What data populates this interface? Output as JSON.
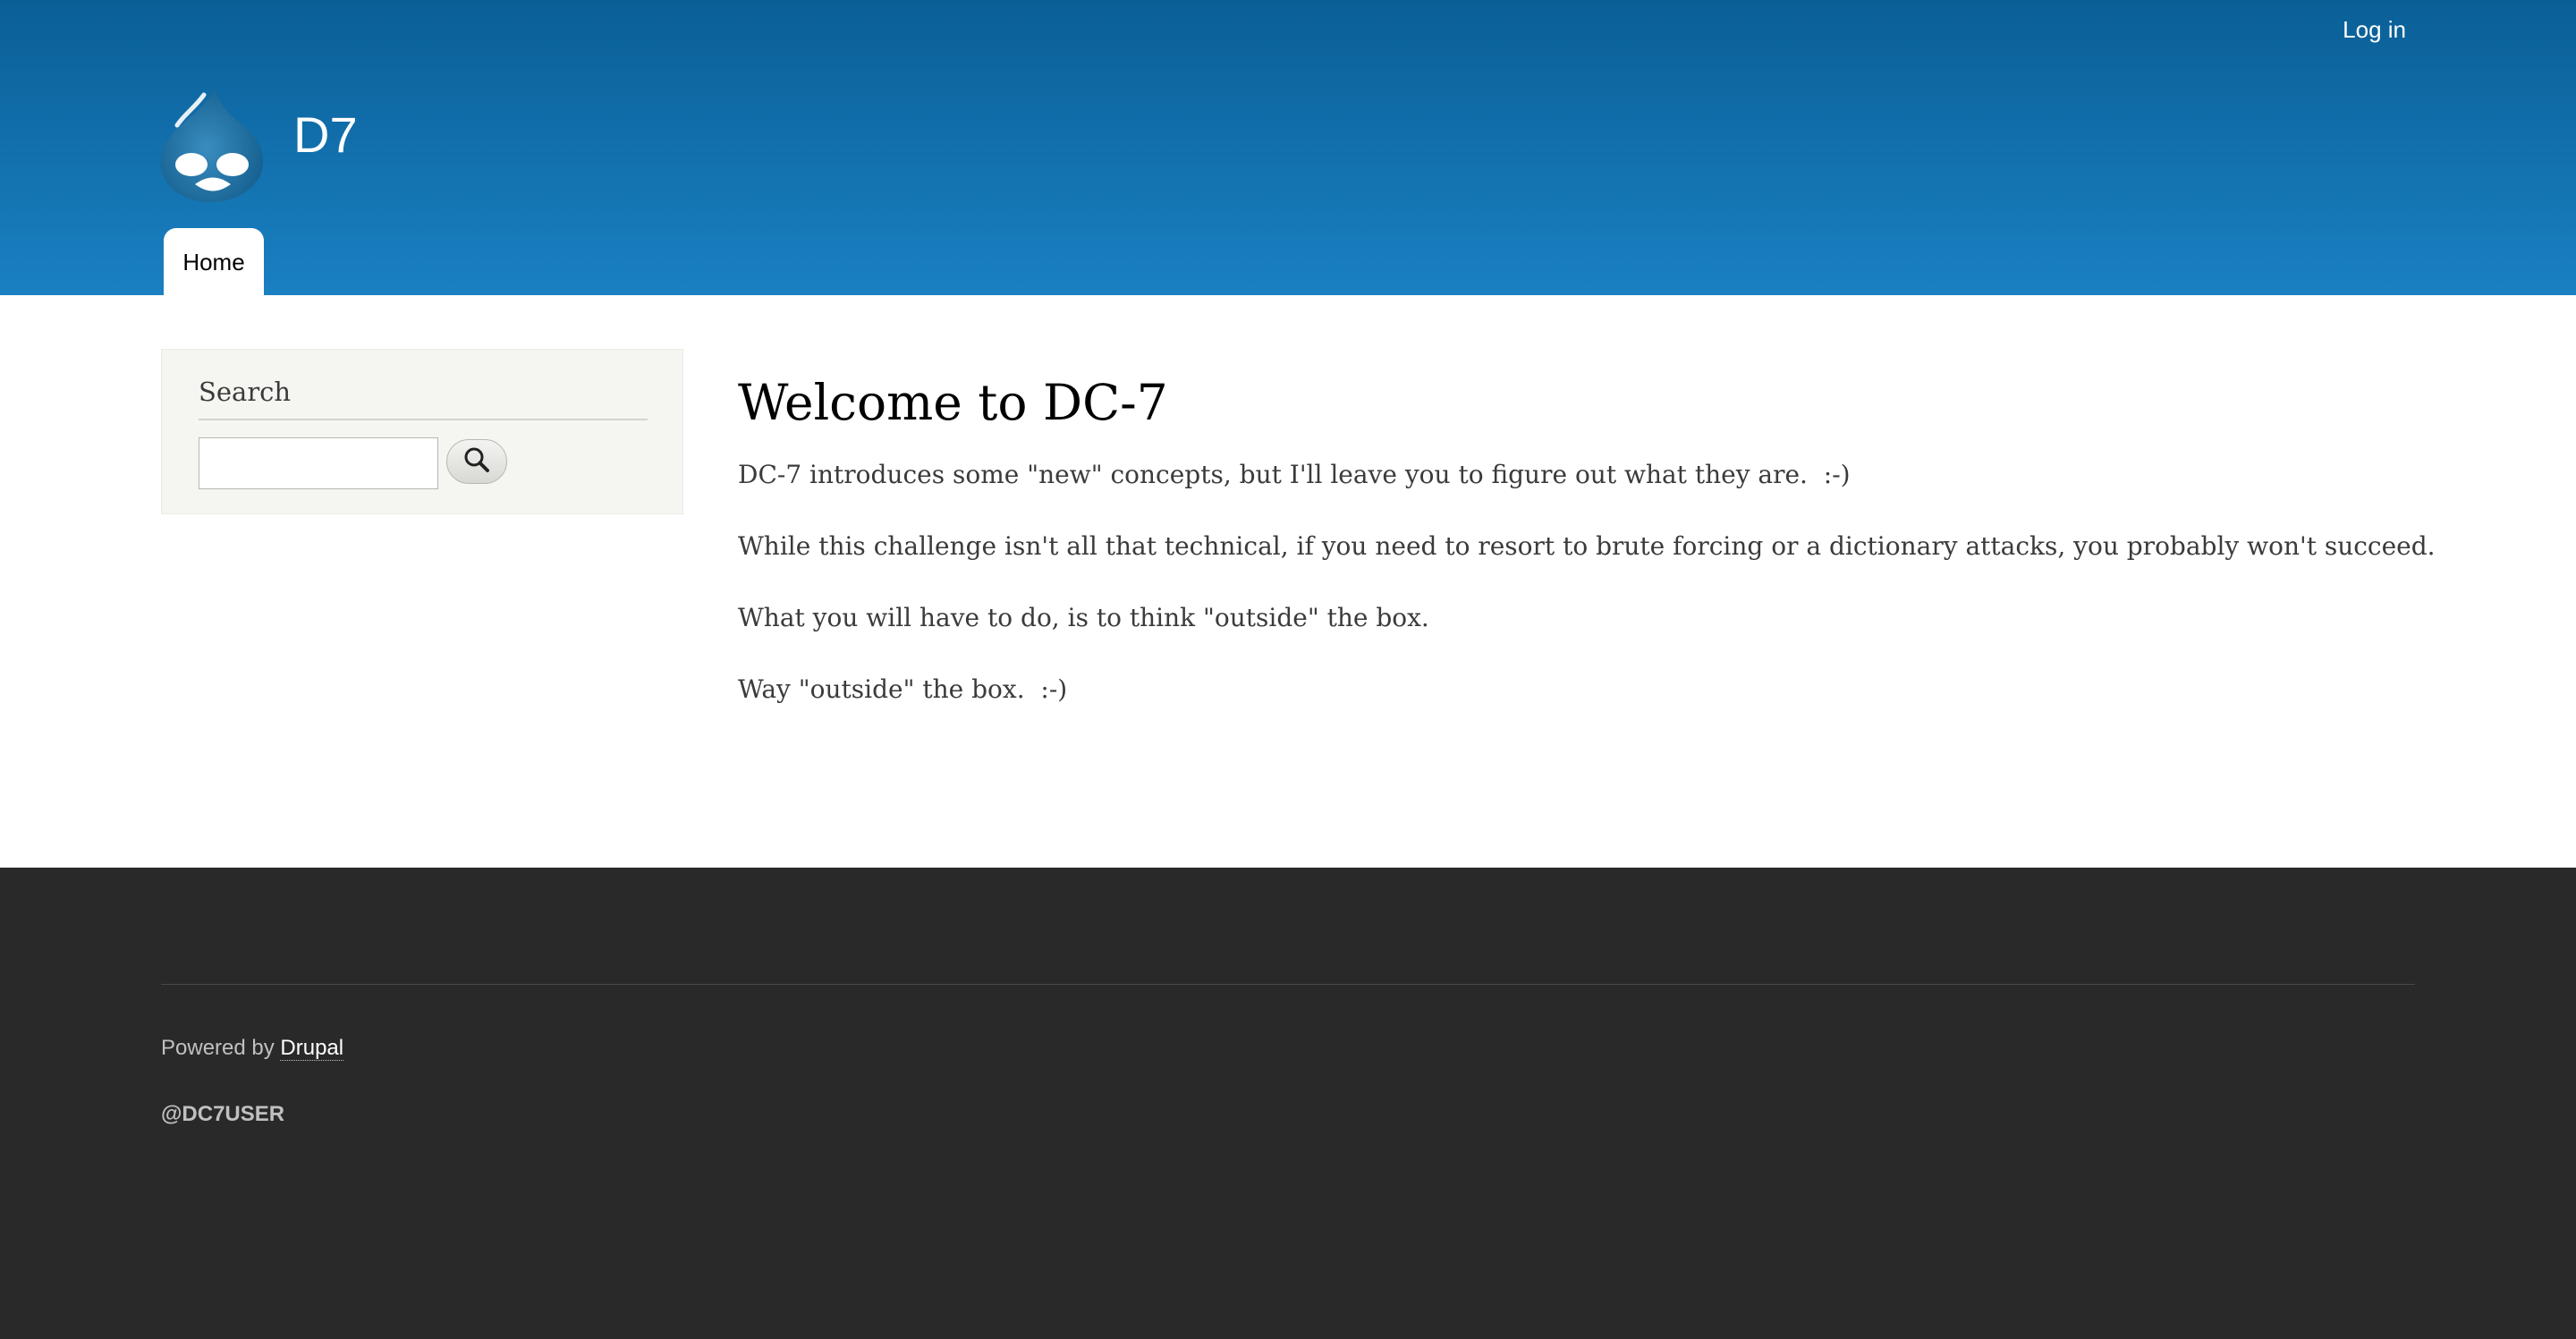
{
  "header": {
    "login_label": "Log in",
    "site_name": "D7",
    "nav": {
      "home_label": "Home"
    },
    "logo_icon": "drupal-drop-icon",
    "gradient_top": "#0a5f96",
    "gradient_bottom": "#1a80c2"
  },
  "sidebar": {
    "search_title": "Search",
    "search_value": "",
    "search_button_icon": "search-icon"
  },
  "main": {
    "title": "Welcome to DC-7",
    "paragraphs": [
      "DC-7 introduces some \"new\" concepts, but I'll leave you to figure out what they are.  :-)",
      "While this challenge isn't all that technical, if you need to resort to brute forcing or a dictionary attacks, you probably won't succeed.",
      "What you will have to do, is to think \"outside\" the box.",
      "Way \"outside\" the box.  :-)"
    ]
  },
  "footer": {
    "powered_prefix": "Powered by ",
    "powered_link": "Drupal",
    "user_handle": "@DC7USER",
    "background": "#292929"
  }
}
